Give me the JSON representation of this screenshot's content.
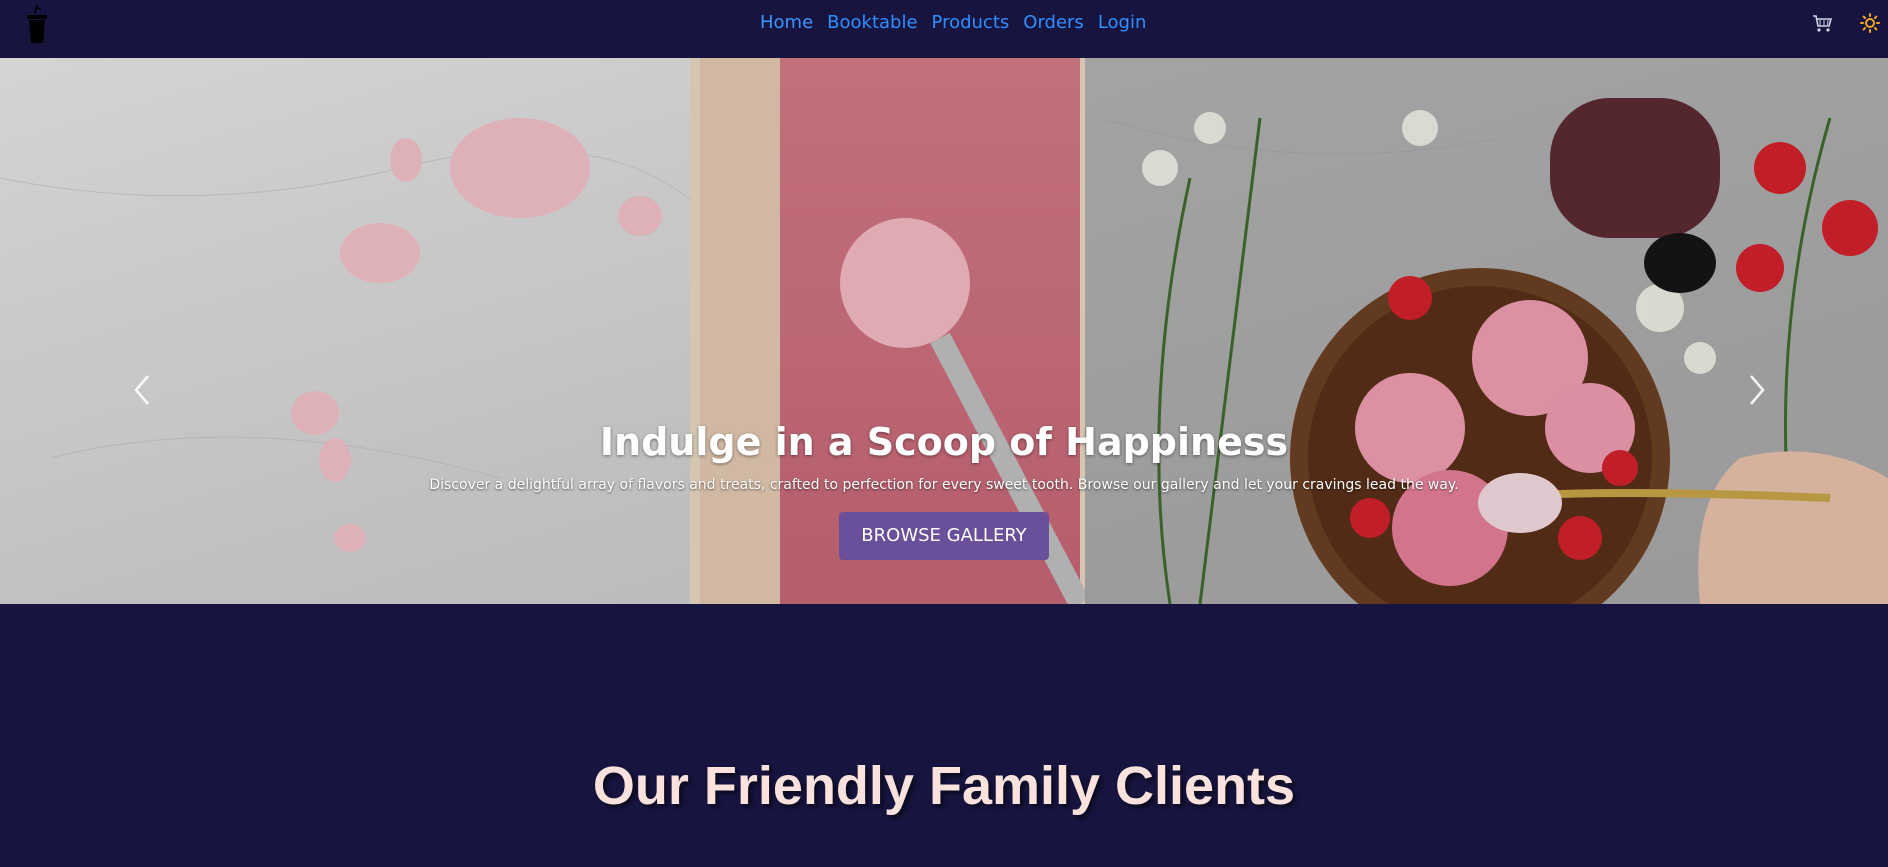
{
  "nav": {
    "logo_icon": "cup-icon",
    "links": [
      "Home",
      "Booktable",
      "Products",
      "Orders",
      "Login"
    ],
    "cart_icon": "cart-icon",
    "theme_icon": "sun-icon",
    "link_color": "#2f8fff",
    "background": "#17143f"
  },
  "hero": {
    "title": "Indulge in a Scoop of Happiness",
    "subtitle": "Discover a delightful array of flavors and treats, crafted to perfection for every sweet tooth. Browse our gallery and let your cravings lead the way.",
    "button_label": "BROWSE GALLERY",
    "button_color": "#6a4f9a",
    "prev_icon": "chevron-left-icon",
    "next_icon": "chevron-right-icon"
  },
  "clients": {
    "heading": "Our Friendly Family Clients",
    "heading_color": "#fbe2dc"
  }
}
